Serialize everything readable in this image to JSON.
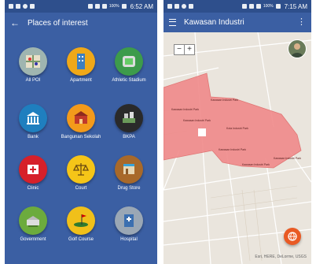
{
  "left": {
    "statusbar": {
      "battery": "100%",
      "time": "6:52 AM"
    },
    "appbar": {
      "title": "Places of interest"
    },
    "items": [
      {
        "label": "All POI",
        "color": "#9fb5b0",
        "icon": "map-grid-icon"
      },
      {
        "label": "Apartment",
        "color": "#f0a818",
        "icon": "building-icon"
      },
      {
        "label": "Athletic Stadium",
        "color": "#3d9b4b",
        "icon": "stadium-icon"
      },
      {
        "label": "Bank",
        "color": "#1f7fbf",
        "icon": "bank-icon"
      },
      {
        "label": "Bangunan Sekolah",
        "color": "#f39a1b",
        "icon": "school-building-icon"
      },
      {
        "label": "BKPA",
        "color": "#2a2a2a",
        "icon": "city-block-icon"
      },
      {
        "label": "Clinic",
        "color": "#d6202a",
        "icon": "clinic-icon"
      },
      {
        "label": "Court",
        "color": "#f5c518",
        "icon": "court-scale-icon"
      },
      {
        "label": "Drug Store",
        "color": "#a8692a",
        "icon": "drug-store-icon"
      },
      {
        "label": "Government",
        "color": "#6cab3d",
        "icon": "government-icon"
      },
      {
        "label": "Golf Course",
        "color": "#f0c01a",
        "icon": "golf-icon"
      },
      {
        "label": "Hospital",
        "color": "#9aa7b5",
        "icon": "hospital-icon"
      }
    ]
  },
  "right": {
    "statusbar": {
      "battery": "100%",
      "time": "7:15 AM"
    },
    "appbar": {
      "title": "Kawasan Industri"
    },
    "zoom": {
      "minus": "−",
      "plus": "+"
    },
    "map": {
      "region_color": "#f08a8a",
      "labels": [
        "Kawasan Industri Park",
        "Kawasan Industri Park",
        "Kota Industri Park",
        "Kawasan Industri Park",
        "Kawasan Industri Park",
        "Kawasan Industri Park",
        "Kawasan Industri Park"
      ],
      "attribution": "Esri, HERE, DeLorme, USGS"
    },
    "fab": {
      "icon": "globe-icon"
    }
  }
}
